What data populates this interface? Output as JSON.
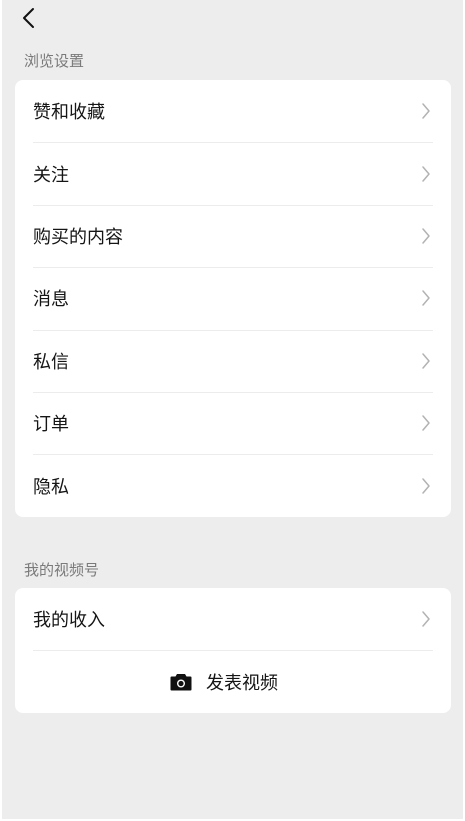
{
  "nav": {
    "back_icon": "chevron-left-icon"
  },
  "sections": {
    "browse_label": "浏览设置",
    "browse_items": [
      {
        "label": "赞和收藏"
      },
      {
        "label": "关注"
      },
      {
        "label": "购买的内容"
      },
      {
        "label": "消息"
      },
      {
        "label": "私信"
      },
      {
        "label": "订单"
      },
      {
        "label": "隐私"
      }
    ],
    "channel_label": "我的视频号",
    "channel_items": [
      {
        "label": "我的收入"
      }
    ],
    "post_video_label": "发表视频",
    "post_video_icon": "camera-icon"
  },
  "colors": {
    "background": "#ededed",
    "card": "#ffffff",
    "chevron": "#b2b2b2"
  }
}
